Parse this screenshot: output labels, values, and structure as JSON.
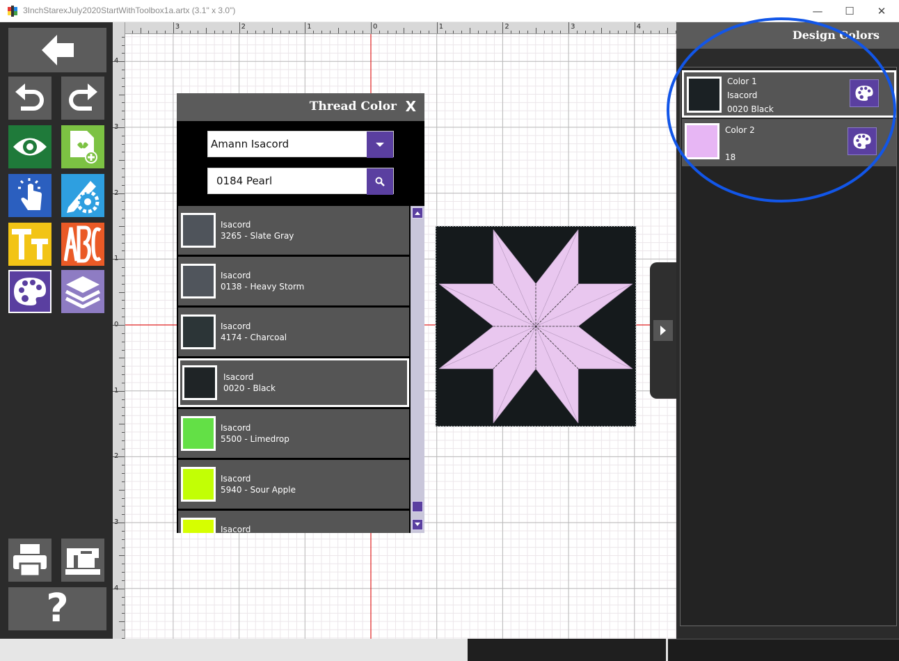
{
  "window": {
    "title": "3InchStarexJuly2020StartWithToolbox1a.artx  (3.1\" x 3.0\")",
    "controls": {
      "minimize": "—",
      "maximize": "☐",
      "close": "✕"
    }
  },
  "toolbar": {
    "buttons": [
      {
        "name": "back",
        "icon": "arrow-left-icon",
        "color": "#5c5c5c"
      },
      {
        "name": "undo",
        "icon": "undo-icon",
        "color": "#5c5c5c"
      },
      {
        "name": "redo",
        "icon": "redo-icon",
        "color": "#5c5c5c"
      },
      {
        "name": "view",
        "icon": "eye-icon",
        "color": "#1f7a3a"
      },
      {
        "name": "new-design",
        "icon": "new-file-icon",
        "color": "#7cc243"
      },
      {
        "name": "select",
        "icon": "touch-select-icon",
        "color": "#2b5fbf"
      },
      {
        "name": "edit-tools",
        "icon": "pencil-gear-icon",
        "color": "#2e9fe0"
      },
      {
        "name": "text",
        "icon": "text-tt-icon",
        "color": "#f2c416"
      },
      {
        "name": "monogram",
        "icon": "monogram-abc-icon",
        "color": "#ea5a26"
      },
      {
        "name": "colors",
        "icon": "palette-icon",
        "color": "#5a3fa0"
      },
      {
        "name": "layers",
        "icon": "layers-icon",
        "color": "#8e7cc3"
      },
      {
        "name": "print",
        "icon": "printer-icon",
        "color": "#5c5c5c"
      },
      {
        "name": "sew",
        "icon": "sewing-machine-icon",
        "color": "#5c5c5c"
      },
      {
        "name": "help",
        "icon": "question-icon",
        "color": "#5c5c5c",
        "label": "?"
      }
    ]
  },
  "rulers": {
    "top": [
      "3",
      "2",
      "1",
      "0",
      "1",
      "2",
      "3",
      "4"
    ],
    "left": [
      "4",
      "3",
      "2",
      "1",
      "0",
      "1",
      "2",
      "3",
      "4"
    ]
  },
  "thread_dialog": {
    "title": "Thread Color",
    "close_label": "X",
    "brand_value": "Amann Isacord",
    "search_value": "0184 Pearl",
    "threads": [
      {
        "brand": "Isacord",
        "name": "3265 - Slate Gray",
        "color": "#4f545b",
        "selected": false
      },
      {
        "brand": "Isacord",
        "name": "0138 - Heavy Storm",
        "color": "#50555c",
        "selected": false
      },
      {
        "brand": "Isacord",
        "name": "4174 - Charcoal",
        "color": "#2c3537",
        "selected": false
      },
      {
        "brand": "Isacord",
        "name": "0020 - Black",
        "color": "#1f2426",
        "selected": true
      },
      {
        "brand": "Isacord",
        "name": "5500 - Limedrop",
        "color": "#63e046",
        "selected": false
      },
      {
        "brand": "Isacord",
        "name": "5940 - Sour Apple",
        "color": "#c2ff05",
        "selected": false
      },
      {
        "brand": "Isacord",
        "name": "",
        "color": "#d6ff00",
        "selected": false
      }
    ]
  },
  "design_colors": {
    "title": "Design Colors",
    "colors": [
      {
        "label": "Color 1",
        "brand": "Isacord",
        "code": "0020 Black",
        "color": "#1b2124",
        "selected": true
      },
      {
        "label": "Color 2",
        "brand": "",
        "code": "18",
        "color": "#e7b6f4",
        "selected": false
      }
    ]
  },
  "colors": {
    "accent": "#5a3fa0",
    "annotation": "#1256e8",
    "canvas_red_line": "#e02020",
    "design_background": "#151a1c",
    "design_star": "#e9c7ef"
  }
}
